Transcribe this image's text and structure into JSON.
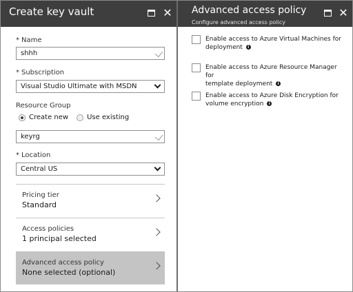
{
  "left_blade": {
    "title": "Create key vault",
    "name": {
      "label": "Name",
      "required_mark": "*",
      "value": "shhh"
    },
    "subscription": {
      "label": "Subscription",
      "required_mark": "*",
      "value": "Visual Studio Ultimate with MSDN"
    },
    "resource_group": {
      "label": "Resource Group",
      "options": [
        {
          "label": "Create new",
          "selected": true
        },
        {
          "label": "Use existing",
          "selected": false
        }
      ],
      "value": "keyrg"
    },
    "location": {
      "label": "Location",
      "required_mark": "*",
      "value": "Central US"
    },
    "nav_items": [
      {
        "label": "Pricing tier",
        "value": "Standard",
        "selected": false
      },
      {
        "label": "Access policies",
        "value": "1 principal selected",
        "selected": false
      },
      {
        "label": "Advanced access policy",
        "value": "None selected (optional)",
        "selected": true
      }
    ]
  },
  "right_blade": {
    "title": "Advanced access policy",
    "subtitle": "Configure advanced access policy",
    "options": [
      {
        "line1": "Enable access to Azure Virtual Machines for",
        "line2": "deployment",
        "checked": false
      },
      {
        "line1": "Enable access to Azure Resource Manager for",
        "line2": "template deployment",
        "checked": false
      },
      {
        "line1": "Enable access to Azure Disk Encryption for",
        "line2": "volume encryption",
        "checked": false
      }
    ]
  },
  "icons": {
    "maximize": "maximize-icon",
    "close": "close-icon",
    "info": "info-icon",
    "chevron_right": "chevron-right-icon",
    "chevron_down": "chevron-down-icon",
    "checkmark": "checkmark-icon"
  },
  "glyphs": {
    "close": "✕",
    "info": "i"
  },
  "colors": {
    "header_bg": "#3e3e3e",
    "selected_item_bg": "#c4c4c4",
    "divider": "#6b6b6b"
  }
}
